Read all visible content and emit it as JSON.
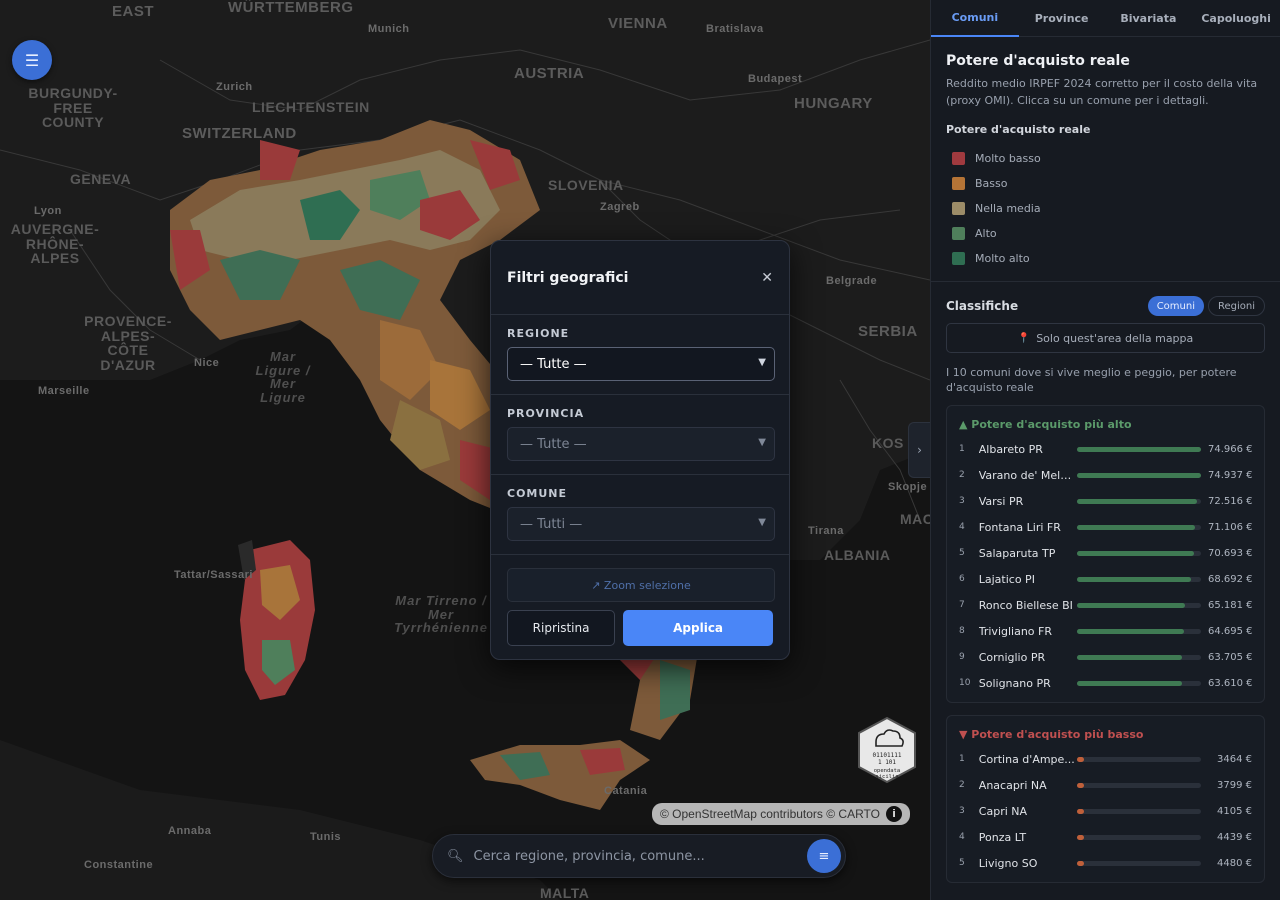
{
  "map": {
    "labels": [
      "EAST",
      "WÜRTTEMBERG",
      "Munich",
      "VIENNA",
      "Bratislava",
      "AUSTRIA",
      "Budapest",
      "HUNGARY",
      "BURGUNDY-FREE COUNTY",
      "Zurich",
      "LIECHTENSTEIN",
      "SWITZERLAND",
      "GENEVA",
      "SLOVENIA",
      "Zagreb",
      "Lyon",
      "AUVERGNE-RHÔNE-ALPES",
      "Belgrade",
      "SERBIA",
      "PROVENCE-ALPES-CÔTE D'AZUR",
      "Nice",
      "Marseille",
      "Mar Ligure / Mer Ligure",
      "KOS",
      "MAC",
      "Skopje",
      "Tirana",
      "ALBANIA",
      "Tattar/Sassari",
      "Mar Tirreno / Mer Tyrrhénienne",
      "Catania",
      "Annaba",
      "Tunis",
      "Constantine",
      "MALTA"
    ],
    "logo_text": "opendata sicilia",
    "attribution": "© OpenStreetMap contributors © CARTO",
    "attribution_info_icon": "info-icon",
    "colors": {
      "molto_basso": "#9a3a3a",
      "basso": "#a8743a",
      "media": "#9b9070",
      "alto": "#4e7a5e",
      "molto_alto": "#2f6e56"
    }
  },
  "search": {
    "placeholder": "Cerca regione, provincia, comune..."
  },
  "modal": {
    "title": "Filtri geografici",
    "regione": {
      "label": "REGIONE",
      "value": "— Tutte —"
    },
    "provincia": {
      "label": "PROVINCIA",
      "value": "— Tutte —"
    },
    "comune": {
      "label": "COMUNE",
      "value": "— Tutti —"
    },
    "zoom_label": "↗ Zoom selezione",
    "reset_label": "Ripristina",
    "apply_label": "Applica"
  },
  "sidebar": {
    "tabs": [
      {
        "label": "Comuni",
        "active": true
      },
      {
        "label": "Province",
        "active": false
      },
      {
        "label": "Bivariata",
        "active": false
      },
      {
        "label": "Capoluoghi",
        "active": false
      }
    ],
    "title": "Potere d'acquisto reale",
    "description": "Reddito medio IRPEF 2024 corretto per il costo della vita (proxy OMI). Clicca su un comune per i dettagli.",
    "legend_title": "Potere d'acquisto reale",
    "legend": [
      {
        "label": "Molto basso",
        "color": "#a03a3f"
      },
      {
        "label": "Basso",
        "color": "#b57436"
      },
      {
        "label": "Nella media",
        "color": "#9c8c68"
      },
      {
        "label": "Alto",
        "color": "#4f7f5b"
      },
      {
        "label": "Molto alto",
        "color": "#2f6e52"
      }
    ],
    "classifiche_title": "Classifiche",
    "pills": {
      "comuni": "Comuni",
      "regioni": "Regioni"
    },
    "area_button": "Solo quest'area della mappa",
    "ranking_description": "I 10 comuni dove si vive meglio e peggio, per potere d'acquisto reale",
    "top_title": "▲ Potere d'acquisto più alto",
    "top": [
      {
        "rank": "1",
        "name": "Albareto PR",
        "value": "74.966 €",
        "fill": 1.0
      },
      {
        "rank": "2",
        "name": "Varano de' Mele...",
        "value": "74.937 €",
        "fill": 0.999
      },
      {
        "rank": "3",
        "name": "Varsi PR",
        "value": "72.516 €",
        "fill": 0.967
      },
      {
        "rank": "4",
        "name": "Fontana Liri FR",
        "value": "71.106 €",
        "fill": 0.948
      },
      {
        "rank": "5",
        "name": "Salaparuta TP",
        "value": "70.693 €",
        "fill": 0.943
      },
      {
        "rank": "6",
        "name": "Lajatico PI",
        "value": "68.692 €",
        "fill": 0.916
      },
      {
        "rank": "7",
        "name": "Ronco Biellese BI",
        "value": "65.181 €",
        "fill": 0.869
      },
      {
        "rank": "8",
        "name": "Trivigliano FR",
        "value": "64.695 €",
        "fill": 0.863
      },
      {
        "rank": "9",
        "name": "Corniglio PR",
        "value": "63.705 €",
        "fill": 0.85
      },
      {
        "rank": "10",
        "name": "Solignano PR",
        "value": "63.610 €",
        "fill": 0.848
      }
    ],
    "bottom_title": "▼ Potere d'acquisto più basso",
    "bottom": [
      {
        "rank": "1",
        "name": "Cortina d'Ampe...",
        "value": "3464 €",
        "fill": 0.046
      },
      {
        "rank": "2",
        "name": "Anacapri NA",
        "value": "3799 €",
        "fill": 0.051
      },
      {
        "rank": "3",
        "name": "Capri NA",
        "value": "4105 €",
        "fill": 0.055
      },
      {
        "rank": "4",
        "name": "Ponza LT",
        "value": "4439 €",
        "fill": 0.059
      },
      {
        "rank": "5",
        "name": "Livigno SO",
        "value": "4480 €",
        "fill": 0.06
      }
    ],
    "top_bar_color": "#3f7a53",
    "bottom_bar_color": "#c0603a"
  }
}
